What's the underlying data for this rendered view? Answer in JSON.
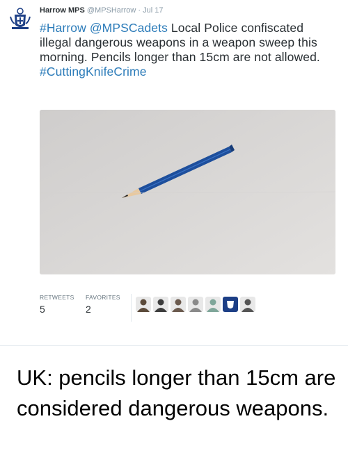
{
  "tweet": {
    "author_name": "Harrow MPS",
    "author_handle": "@MPSHarrow",
    "separator": "·",
    "date": "Jul 17",
    "hashtag_harrow": "#Harrow",
    "mention": "@MPSCadets",
    "text_main": " Local Police confiscated illegal dangerous weapons in a weapon sweep this morning. Pencils longer than 15cm are not allowed.",
    "hashtag_end": "#CuttingKnifeCrime"
  },
  "stats": {
    "retweets_label": "RETWEETS",
    "retweets_count": "5",
    "favorites_label": "FAVORITES",
    "favorites_count": "2"
  },
  "favoriters": [
    {
      "icon": "user-avatar-icon",
      "color": "#5b4a3a"
    },
    {
      "icon": "user-avatar-icon",
      "color": "#3d3d3d"
    },
    {
      "icon": "user-avatar-icon",
      "color": "#6b5a4e"
    },
    {
      "icon": "user-avatar-icon",
      "color": "#8a8a8a"
    },
    {
      "icon": "user-avatar-icon",
      "color": "#7fa69a"
    },
    {
      "icon": "police-crest-icon",
      "color": "#1d3f86"
    },
    {
      "icon": "user-avatar-icon",
      "color": "#555555"
    }
  ],
  "caption": "UK: pencils longer than 15cm are considered dangerous weapons.",
  "colors": {
    "link": "#2b7bb9",
    "pencil_body": "#1e4f9c",
    "surface": "#d9d7d6"
  }
}
